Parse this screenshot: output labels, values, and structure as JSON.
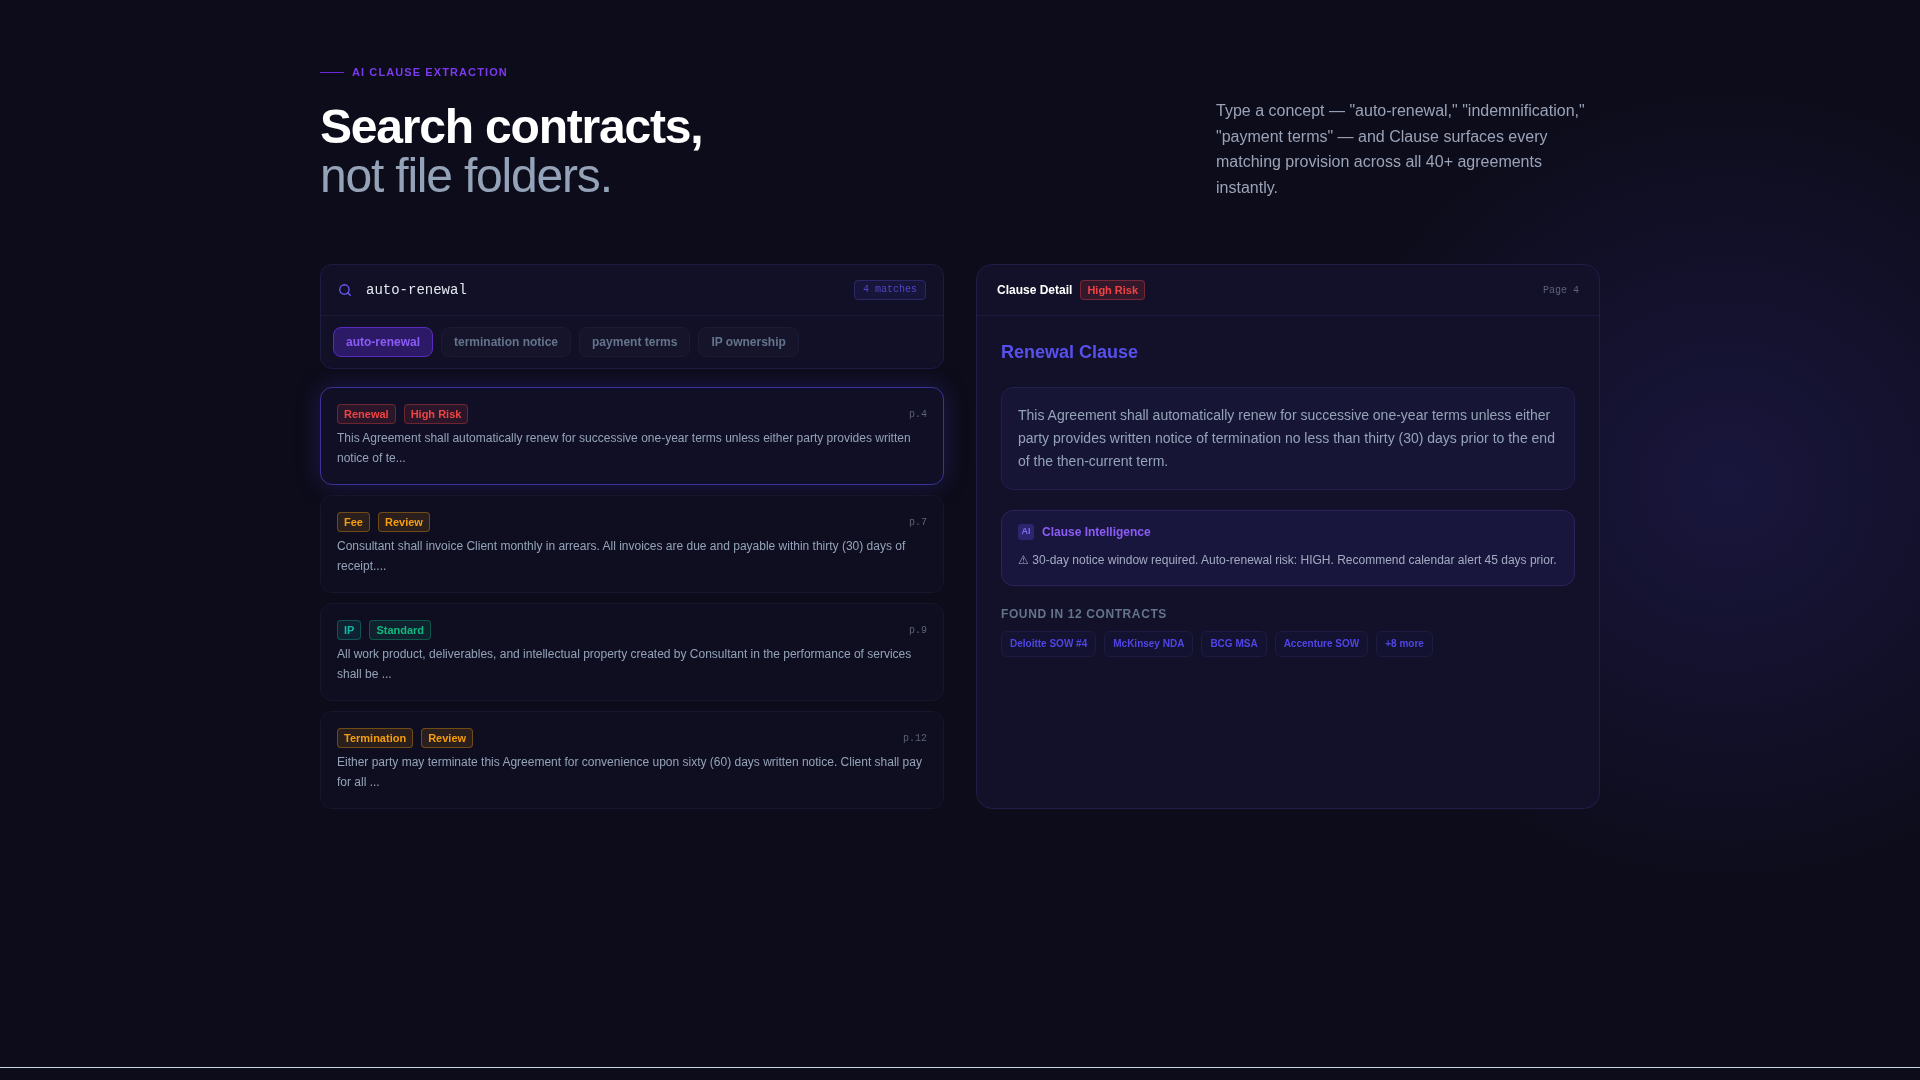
{
  "eyebrow": "AI CLAUSE EXTRACTION",
  "heading": {
    "line_1": "Search contracts,",
    "line_2": "not file folders."
  },
  "intro": "Type a concept — \"auto-renewal,\" \"indemnification,\" \"payment terms\" — and Clause surfaces every matching provision across all 40+ agreements instantly.",
  "search": {
    "value": "auto-renewal",
    "match_count": "4 matches",
    "suggestions": [
      {
        "label": "auto-renewal",
        "selected": true
      },
      {
        "label": "termination notice",
        "selected": false
      },
      {
        "label": "payment terms",
        "selected": false
      },
      {
        "label": "IP ownership",
        "selected": false
      }
    ]
  },
  "results": [
    {
      "selected": true,
      "tags": [
        {
          "label": "Renewal",
          "color": "#ef4444"
        },
        {
          "label": "High Risk",
          "color": "#ef4444"
        }
      ],
      "page": "p.4",
      "excerpt": "This Agreement shall automatically renew for successive one-year terms unless either party provides written notice of te..."
    },
    {
      "selected": false,
      "tags": [
        {
          "label": "Fee",
          "color": "#f59e0b"
        },
        {
          "label": "Review",
          "color": "#f59e0b"
        }
      ],
      "page": "p.7",
      "excerpt": "Consultant shall invoice Client monthly in arrears. All invoices are due and payable within thirty (30) days of receipt...."
    },
    {
      "selected": false,
      "tags": [
        {
          "label": "IP",
          "color": "#14b8a6"
        },
        {
          "label": "Standard",
          "color": "#10b981"
        }
      ],
      "page": "p.9",
      "excerpt": "All work product, deliverables, and intellectual property created by Consultant in the performance of services shall be ..."
    },
    {
      "selected": false,
      "tags": [
        {
          "label": "Termination",
          "color": "#f59e0b"
        },
        {
          "label": "Review",
          "color": "#f59e0b"
        }
      ],
      "page": "p.12",
      "excerpt": "Either party may terminate this Agreement for convenience upon sixty (60) days written notice. Client shall pay for all ..."
    }
  ],
  "detail": {
    "title": "Clause Detail",
    "risk": "High Risk",
    "page": "Page 4",
    "clause_title": "Renewal Clause",
    "clause_text": "This Agreement shall automatically renew for successive one-year terms unless either party provides written notice of termination no less than thirty (30) days prior to the end of the then-current term.",
    "intelligence": {
      "badge": "AI",
      "title": "Clause Intelligence",
      "note": "⚠ 30-day notice window required. Auto-renewal risk: HIGH. Recommend calendar alert 45 days prior."
    },
    "found_in": {
      "label": "FOUND IN 12 CONTRACTS",
      "contracts": [
        "Deloitte SOW #4",
        "McKinsey NDA",
        "BCG MSA",
        "Accenture SOW",
        "+8 more"
      ]
    }
  }
}
